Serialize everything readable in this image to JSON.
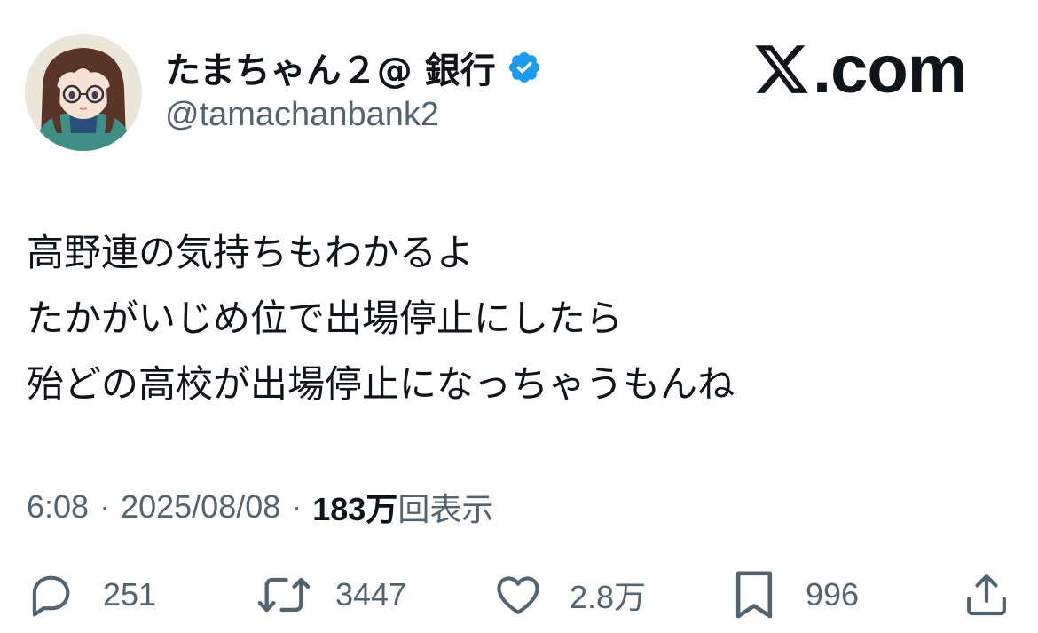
{
  "author": {
    "display_name": "たまちゃん２@ 銀行",
    "handle": "@tamachanbank2",
    "verified": true
  },
  "branding": {
    "logo_text": ".com",
    "logo_icon": "x-logo-icon"
  },
  "tweet": {
    "lines": [
      "高野連の気持ちもわかるよ",
      "たかがいじめ位で出場停止にしたら",
      "殆どの高校が出場停止になっちゃうもんね"
    ]
  },
  "meta": {
    "time": "6:08",
    "separator": "·",
    "date": "2025/08/08",
    "views_count": "183万",
    "views_label": "回表示"
  },
  "actions": {
    "reply": {
      "icon": "reply-icon",
      "count": "251"
    },
    "repost": {
      "icon": "repost-icon",
      "count": "3447"
    },
    "like": {
      "icon": "heart-icon",
      "count": "2.8万"
    },
    "bookmark": {
      "icon": "bookmark-icon",
      "count": "996"
    },
    "share": {
      "icon": "share-icon"
    }
  },
  "colors": {
    "text_primary": "#0f1419",
    "text_secondary": "#536471",
    "verified_blue": "#1d9bf0"
  }
}
